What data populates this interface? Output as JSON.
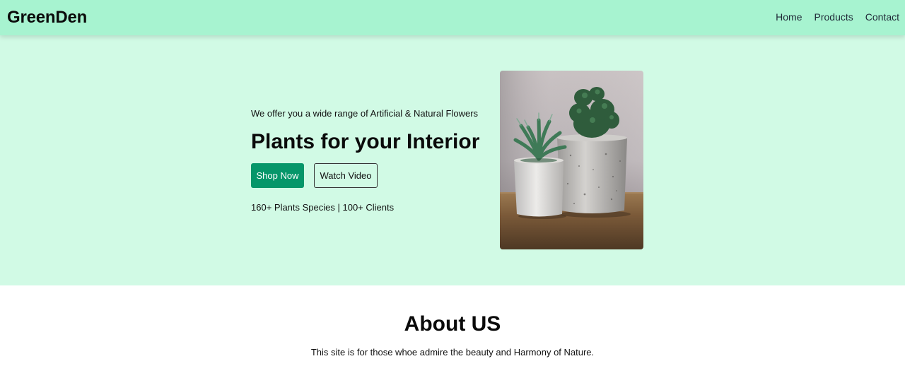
{
  "nav": {
    "brand": "GreenDen",
    "links": [
      "Home",
      "Products",
      "Contact"
    ]
  },
  "hero": {
    "tagline": "We offer you a wide range of Artificial & Natural Flowers",
    "title": "Plants for your Interior",
    "primary_button": "Shop Now",
    "secondary_button": "Watch Video",
    "stats": "160+ Plants Species | 100+ Clients"
  },
  "about": {
    "title": "About US",
    "text": "This site is for those whoe admire the beauty and Harmony of Nature."
  },
  "colors": {
    "navbar": "#a7f3d0",
    "hero_background": "#d1fae5",
    "primary_button": "#059669"
  }
}
